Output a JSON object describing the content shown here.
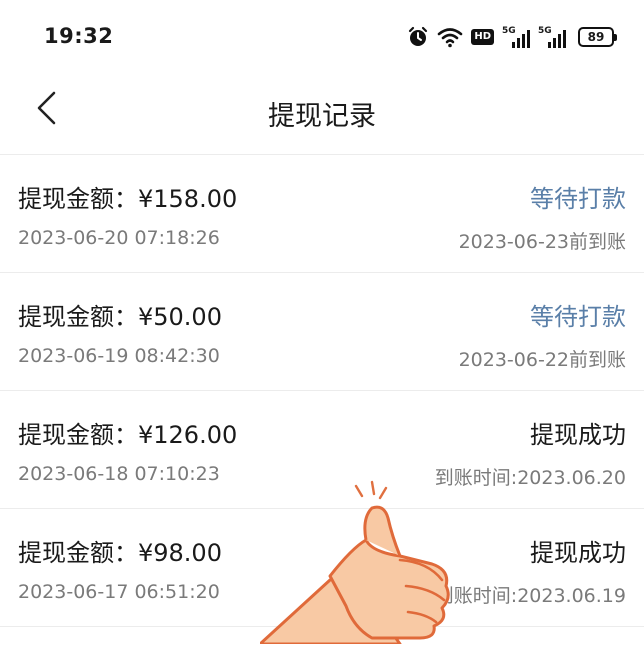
{
  "status_bar": {
    "time": "19:32",
    "network1": "5G",
    "network2": "5G",
    "hd_label": "HD",
    "battery": "89"
  },
  "nav": {
    "title": "提现记录",
    "back_icon": "chevron-left-icon"
  },
  "records": [
    {
      "amount": "提现金额：¥158.00",
      "status": "等待打款",
      "status_kind": "pending",
      "time": "2023-06-20 07:18:26",
      "arrival": "2023-06-23前到账"
    },
    {
      "amount": "提现金额：¥50.00",
      "status": "等待打款",
      "status_kind": "pending",
      "time": "2023-06-19 08:42:30",
      "arrival": "2023-06-22前到账"
    },
    {
      "amount": "提现金额：¥126.00",
      "status": "提现成功",
      "status_kind": "done",
      "time": "2023-06-18 07:10:23",
      "arrival": "到账时间:2023.06.20"
    },
    {
      "amount": "提现金额：¥98.00",
      "status": "提现成功",
      "status_kind": "done",
      "time": "2023-06-17 06:51:20",
      "arrival": "到账时间:2023.06.19"
    }
  ],
  "colors": {
    "pending": "#5a7fa8",
    "done": "#1a1a1a",
    "secondary_text": "#7a7a7a",
    "divider": "#ececec"
  }
}
